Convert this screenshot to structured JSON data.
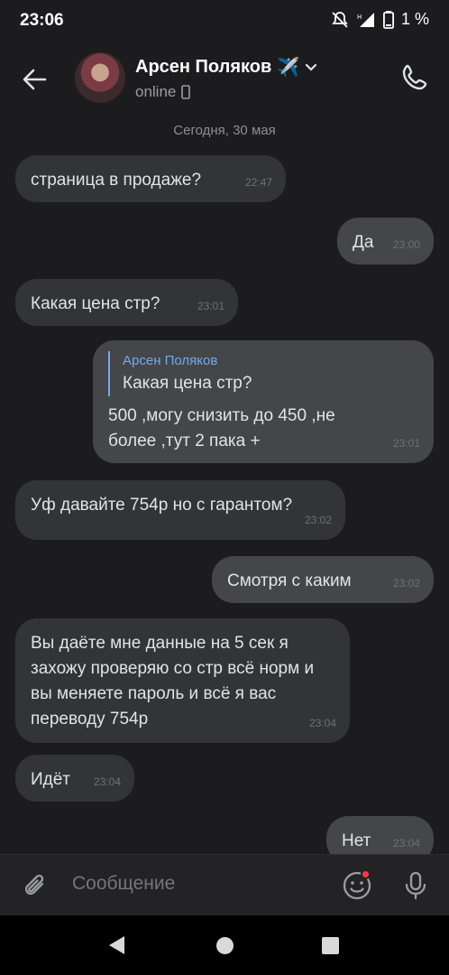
{
  "status_bar": {
    "time": "23:06",
    "battery_percent": "1 %",
    "icons": [
      "do-not-disturb-icon",
      "signal-icon",
      "battery-icon"
    ]
  },
  "header": {
    "contact_name": "Арсен Поляков",
    "name_emoji": "✈️",
    "status": "online",
    "icons": [
      "back-arrow-icon",
      "chevron-down-icon",
      "phone-icon",
      "call-icon"
    ]
  },
  "chat": {
    "date_separator": "Сегодня, 30 мая",
    "messages": [
      {
        "direction": "in",
        "text": "страница в продаже?",
        "time": "22:47"
      },
      {
        "direction": "out",
        "text": "Да",
        "time": "23:00"
      },
      {
        "direction": "in",
        "text": "Какая цена стр?",
        "time": "23:01"
      },
      {
        "direction": "out",
        "reply_author": "Арсен Поляков",
        "reply_text": "Какая цена стр?",
        "text": "500 ,могу снизить до 450 ,не более ,тут 2 пака +",
        "time": "23:01"
      },
      {
        "direction": "in",
        "text": "Уф давайте 754р но с гарантом?",
        "time": "23:02"
      },
      {
        "direction": "out",
        "text": "Смотря с каким",
        "time": "23:02"
      },
      {
        "direction": "in",
        "text": "Вы даёте мне данные на 5 сек я захожу проверяю со стр всё норм и вы меняете пароль и всё я вас переводу 754р",
        "time": "23:04"
      },
      {
        "direction": "in",
        "text": "Идёт",
        "time": "23:04"
      },
      {
        "direction": "out",
        "text": "Нет",
        "time": "23:04"
      }
    ]
  },
  "composer": {
    "placeholder": "Сообщение",
    "icons": [
      "paperclip-icon",
      "emoji-icon",
      "microphone-icon"
    ]
  },
  "colors": {
    "background": "#1c1c1e",
    "incoming_bubble": "#333436",
    "outgoing_bubble": "#45464a",
    "reply_accent": "#71aaeb",
    "notification_dot": "#ff3347"
  }
}
